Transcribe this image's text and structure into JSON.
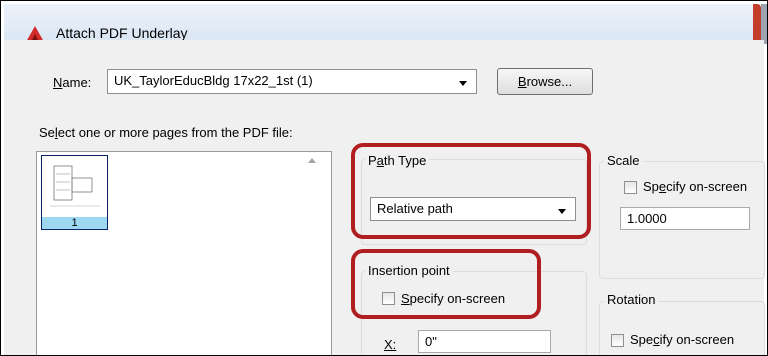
{
  "dialog": {
    "title": "Attach PDF Underlay"
  },
  "name_row": {
    "label_pre": "",
    "label_accel": "N",
    "label_post": "ame:",
    "value": "UK_TaylorEducBldg 17x22_1st (1)",
    "browse_accel": "B",
    "browse_post": "rowse..."
  },
  "pages": {
    "instruction_pre": "Se",
    "instruction_accel": "l",
    "instruction_post": "ect one or more pages from the PDF file:",
    "items": [
      {
        "label": "1"
      }
    ]
  },
  "path_type": {
    "title_pre": "P",
    "title_accel": "a",
    "title_post": "th Type",
    "value": "Relative path"
  },
  "insertion_point": {
    "title": "Insertion point",
    "specify_pre": "",
    "specify_accel": "S",
    "specify_post": "pecify on-screen",
    "specify_checked": false,
    "x_label": "X:",
    "x_value": "0\""
  },
  "scale": {
    "title": "Scale",
    "specify_pre": "Sp",
    "specify_accel": "e",
    "specify_post": "cify on-screen",
    "specify_checked": false,
    "value": "1.0000"
  },
  "rotation": {
    "title": "Rotation",
    "specify_pre": "Spe",
    "specify_accel": "c",
    "specify_post": "ify on-screen",
    "specify_checked": false
  },
  "highlight_color": "#b01e22",
  "icons": {
    "title": "autocad-app-icon",
    "dropdown": "chevron-down-icon"
  }
}
